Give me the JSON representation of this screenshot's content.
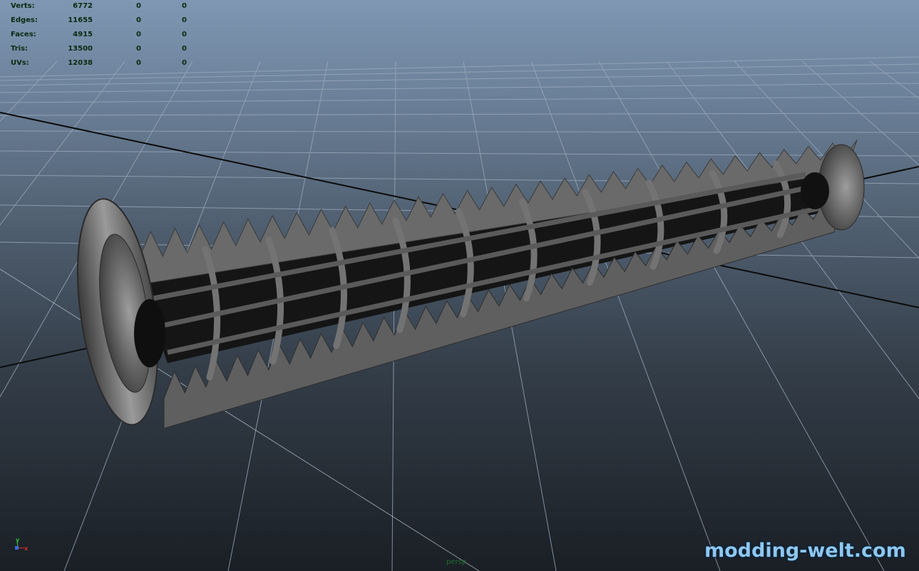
{
  "hud": {
    "rows": [
      {
        "label": "Verts:",
        "value": "6772",
        "selected": "0",
        "component": "0"
      },
      {
        "label": "Edges:",
        "value": "11655",
        "selected": "0",
        "component": "0"
      },
      {
        "label": "Faces:",
        "value": "4915",
        "selected": "0",
        "component": "0"
      },
      {
        "label": "Tris:",
        "value": "13500",
        "selected": "0",
        "component": "0"
      },
      {
        "label": "UVs:",
        "value": "12038",
        "selected": "0",
        "component": "0"
      }
    ]
  },
  "axis": {
    "y_label": "y",
    "x_label": "x"
  },
  "camera_label": "persp",
  "watermark": "modding-welt.com",
  "colors": {
    "hud_text": "#0a2a10",
    "model_gray": "#606060",
    "grid": "#9aa9ba",
    "axis_line": "#0c0c0c",
    "watermark": "#8fc7ee"
  }
}
